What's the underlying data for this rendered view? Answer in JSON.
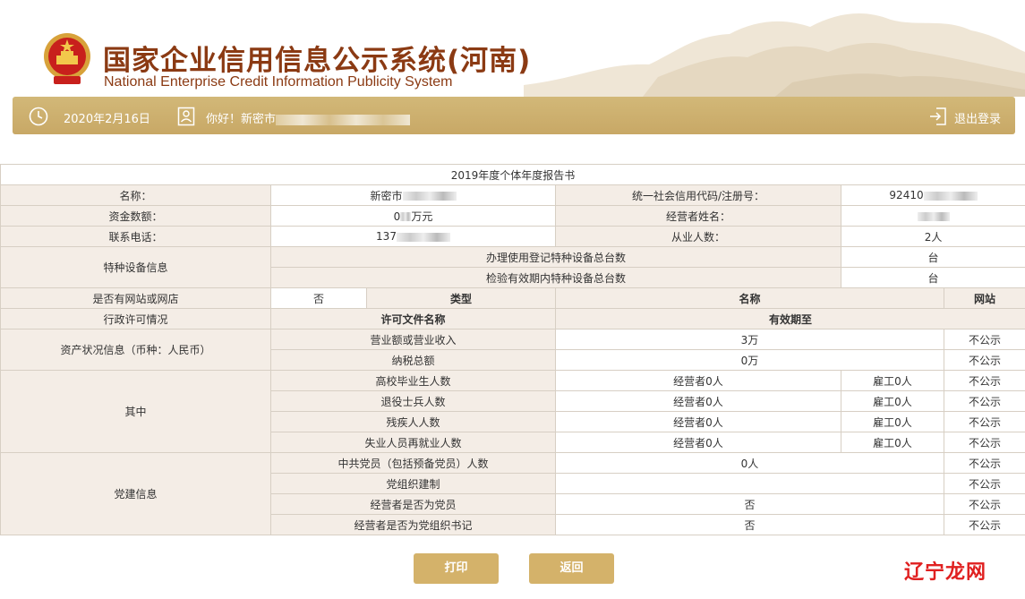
{
  "header": {
    "title_cn": "国家企业信用信息公示系统(河南)",
    "title_en": "National Enterprise Credit Information Publicity System"
  },
  "toolbar": {
    "date": "2020年2月16日",
    "greeting": "你好！新密市",
    "logout_label": "退出登录"
  },
  "report": {
    "caption": "2019年度个体年度报告书",
    "name_label": "名称：",
    "name_value": "新密市",
    "uscc_label": "统一社会信用代码/注册号：",
    "uscc_value": "92410",
    "capital_label": "资金数额：",
    "capital_value": "0",
    "capital_unit": "万元",
    "operator_label": "经营者姓名：",
    "phone_label": "联系电话：",
    "phone_value": "137",
    "employees_label": "从业人数：",
    "employees_value": "2人",
    "equip_label": "特种设备信息",
    "equip_row1_label": "办理使用登记特种设备总台数",
    "equip_row1_unit": "台",
    "equip_row2_label": "检验有效期内特种设备总台数",
    "equip_row2_unit": "台",
    "website_label": "是否有网站或网店",
    "website_value": "否",
    "col_type": "类型",
    "col_name": "名称",
    "col_site": "网站",
    "license_label": "行政许可情况",
    "col_license_name": "许可文件名称",
    "col_valid_until": "有效期至",
    "assets_label": "资产状况信息（币种：人民币）",
    "revenue_label": "营业额或营业收入",
    "revenue_value": "3万",
    "tax_label": "纳税总额",
    "tax_value": "0万",
    "not_public": "不公示",
    "among_label": "其中",
    "among_rows": [
      {
        "label": "高校毕业生人数",
        "operator": "经营者0人",
        "employed": "雇工0人"
      },
      {
        "label": "退役士兵人数",
        "operator": "经营者0人",
        "employed": "雇工0人"
      },
      {
        "label": "残疾人人数",
        "operator": "经营者0人",
        "employed": "雇工0人"
      },
      {
        "label": "失业人员再就业人数",
        "operator": "经营者0人",
        "employed": "雇工0人"
      }
    ],
    "party_label": "党建信息",
    "party_rows": [
      {
        "label": "中共党员（包括预备党员）人数",
        "value": "0人"
      },
      {
        "label": "党组织建制",
        "value": ""
      },
      {
        "label": "经营者是否为党员",
        "value": "否"
      },
      {
        "label": "经营者是否为党组织书记",
        "value": "否"
      }
    ]
  },
  "buttons": {
    "print": "打印",
    "back": "返回"
  },
  "watermark": {
    "text": "辽宁龙网"
  },
  "colors": {
    "brand_brown": "#8b3a13",
    "bar_gold": "#c8a866",
    "button_gold": "#d4b26a",
    "label_bg": "#f4ede6"
  }
}
